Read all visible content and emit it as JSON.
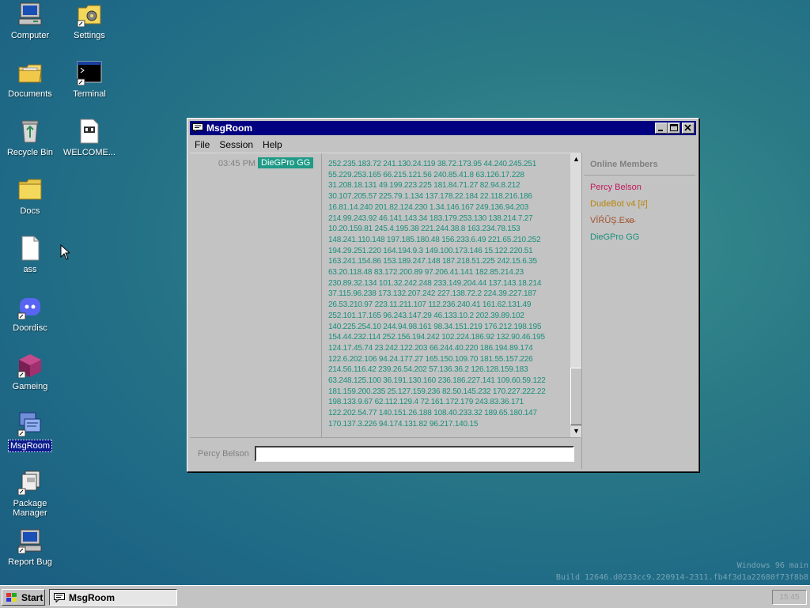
{
  "desktop": {
    "icons": [
      {
        "label": "Computer"
      },
      {
        "label": "Settings"
      },
      {
        "label": "Documents"
      },
      {
        "label": "Terminal"
      },
      {
        "label": "Recycle Bin"
      },
      {
        "label": "WELCOME..."
      },
      {
        "label": "Docs"
      },
      {
        "label": "ass"
      },
      {
        "label": "Doordisc"
      },
      {
        "label": "Gameing"
      },
      {
        "label": "MsgRoom"
      },
      {
        "label": "Package Manager"
      },
      {
        "label": "Report Bug"
      }
    ],
    "watermark": {
      "line1": "Windows 96 main",
      "line2": "Build 12646.d0233cc9.220914-2311.fb4f3d1a22680f73f8b8"
    }
  },
  "window": {
    "title": "MsgRoom",
    "menu": [
      "File",
      "Session",
      "Help"
    ],
    "message": {
      "time": "03:45 PM",
      "user": "DieGPro GG",
      "text": "252.235.183.72 241.130.24.119 38.72.173.95 44.240.245.251 55.229.253.165 66.215.121.56 240.85.41.8 63.126.17.228 31.208.18.131 49.199.223.225 181.84.71.27 82.94.8.212 30.107.205.57 225.79.1.134 137.178.22.184 22.118.216.186 16.81.14.240 201.82.124.230 1.34.146.167 249.136.94.203 214.99.243.92 46.141.143.34 183.179.253.130 138.214.7.27 10.20.159.81 245.4.195.38 221.244.38.8 163.234.78.153 148.241.110.148 197.185.180.48 156.233.6.49 221.65.210.252 194.29.251.220 164.194.9.3 149.100.173.146 15.122.220.51 163.241.154.86 153.189.247.148 187.218.51.225 242.15.6.35 63.20.118.48 83.172.200.89 97.206.41.141 182.85.214.23 230.89.32.134 101.32.242.248 233.149.204.44 137.143.18.214 37.115.96.238 173.132.207.242 227.138.72.2 224.39.227.187 26.53.210.97 223.11.211.107 112.236.240.41 161.62.131.49 252.101.17.165 96.243.147.29 46.133.10.2 202.39.89.102 140.225.254.10 244.94.98.161 98.34.151.219 176.212.198.195 154.44.232.114 252.156.194.242 102.224.186.92 132.90.46.195 124.17.45.74 23.242.122.203 66.244.40.220 186.194.89.174 122.6.202.106 94.24.177.27 165.150.109.70 181.55.157.226 214.56.116.42 239.26.54.202 57.136.36.2 126.128.159.183 63.248.125.100 36.191.130.160 236.186.227.141 109.60.59.122 181.159.200.235 25.127.159.236 82.50.145.232 170.227.222.22 198.133.9.67 62.112.129.4 72.161.172.179 243.83.36.171 122.202.54.77 140.151.26.188 108.40.233.32 189.65.180.147 170.137.3.226 94.174.131.82 96.217.140.15"
    },
    "input": {
      "nick": "Percy Belson",
      "value": ""
    },
    "members": {
      "header": "Online Members",
      "list": [
        {
          "name": "Percy Belson",
          "color": "#c2185b"
        },
        {
          "name": "DudeBot v4 [#]",
          "color": "#b8860b"
        },
        {
          "name": "VÏŔŨŞ.Ex̵e̵",
          "color": "#a0522d"
        },
        {
          "name": "DieGPro GG",
          "color": "#1a8f7c"
        }
      ]
    }
  },
  "taskbar": {
    "start_label": "Start",
    "task_label": "MsgRoom",
    "clock": "15:45"
  }
}
